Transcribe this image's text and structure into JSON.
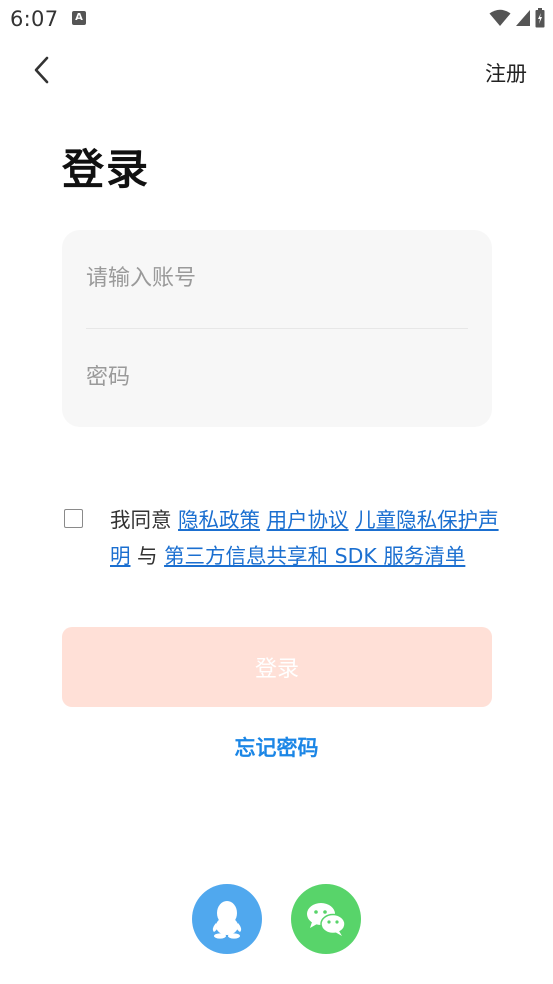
{
  "status_bar": {
    "time": "6:07",
    "notification_icon": "A"
  },
  "header": {
    "back_icon": "chevron-left-icon",
    "register_label": "注册"
  },
  "title": "登录",
  "form": {
    "account_placeholder": "请输入账号",
    "password_placeholder": "密码"
  },
  "agreement": {
    "prefix": "我同意",
    "privacy_policy": "隐私政策",
    "user_agreement": "用户协议",
    "children_privacy": "儿童隐私保护声明",
    "connector": "与",
    "third_party": "第三方信息共享和 SDK 服务清单"
  },
  "login_button": "登录",
  "forgot_password": "忘记密码",
  "social": {
    "qq_icon": "qq-icon",
    "wechat_icon": "wechat-icon"
  },
  "colors": {
    "login_button_bg": "#ffe0d7",
    "link": "#1b6fd0",
    "forgot": "#1b86e6",
    "qq": "#50a8ee",
    "wechat": "#58d46a"
  }
}
